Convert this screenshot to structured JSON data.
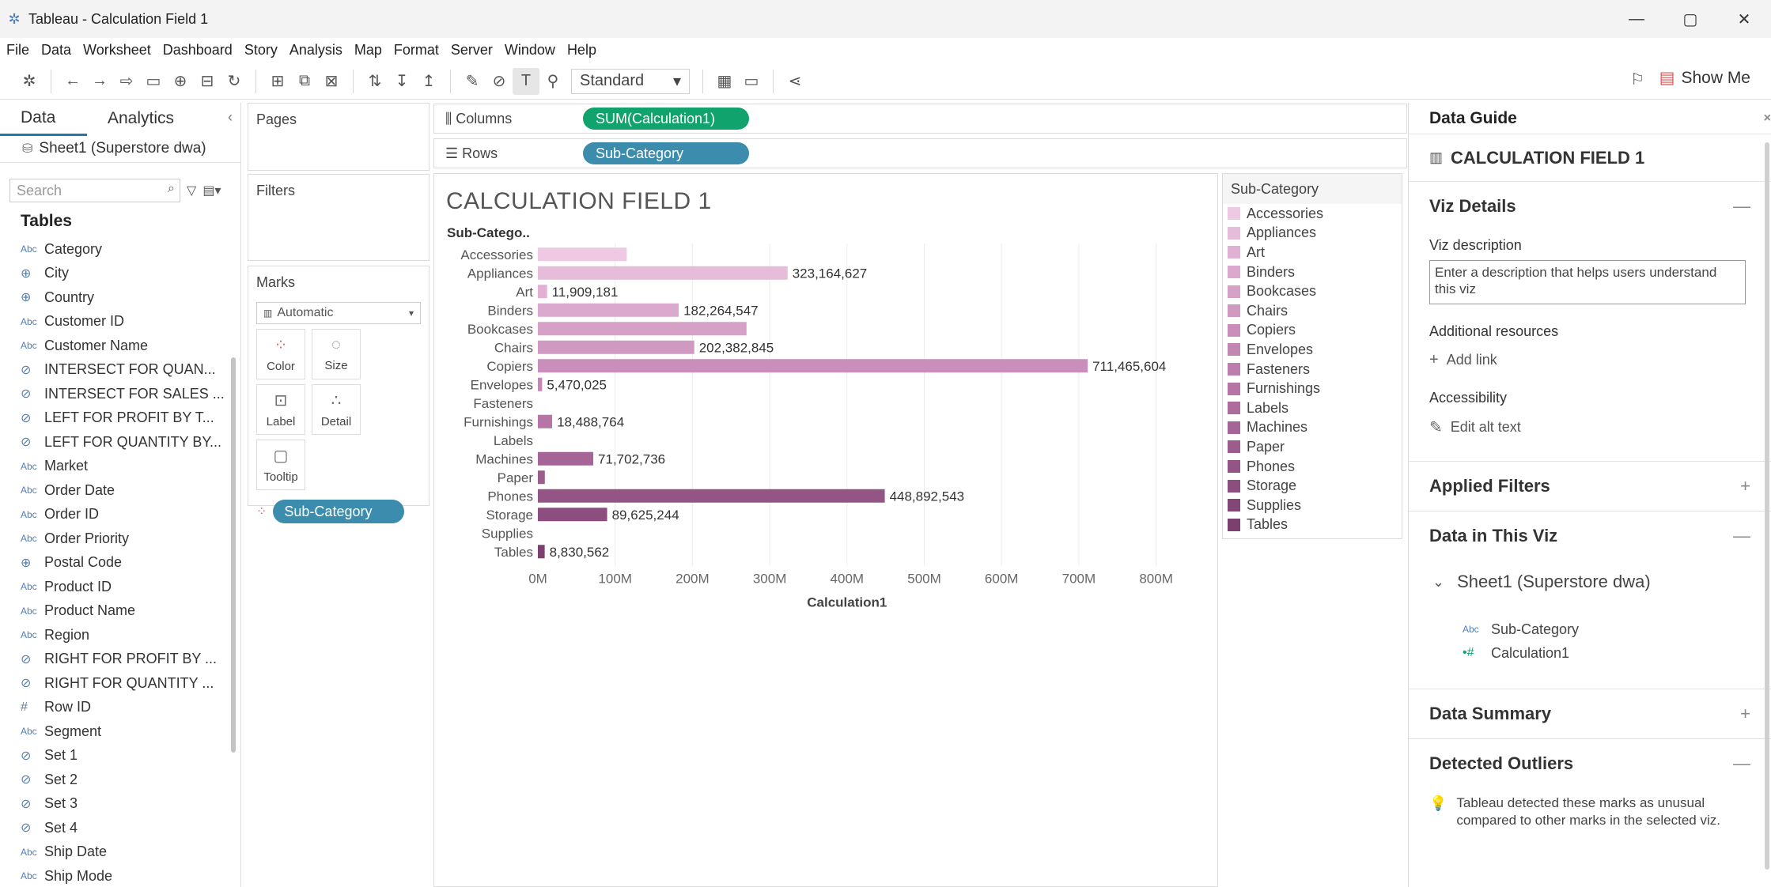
{
  "window": {
    "title": "Tableau - Calculation Field 1",
    "controls": [
      "—",
      "▢",
      "✕"
    ]
  },
  "menu": [
    "File",
    "Data",
    "Worksheet",
    "Dashboard",
    "Story",
    "Analysis",
    "Map",
    "Format",
    "Server",
    "Window",
    "Help"
  ],
  "toolbar": {
    "fit_select": "Standard",
    "show_me": "Show Me"
  },
  "left_panel": {
    "tab_data": "Data",
    "tab_analytics": "Analytics",
    "datasource": "Sheet1 (Superstore dwa)",
    "search_placeholder": "Search",
    "tables_heading": "Tables",
    "fields": [
      {
        "type": "Abc",
        "name": "Category"
      },
      {
        "type": "globe",
        "name": "City"
      },
      {
        "type": "globe",
        "name": "Country"
      },
      {
        "type": "Abc",
        "name": "Customer ID"
      },
      {
        "type": "Abc",
        "name": "Customer Name"
      },
      {
        "type": "set",
        "name": "INTERSECT FOR QUAN..."
      },
      {
        "type": "set",
        "name": "INTERSECT FOR SALES ..."
      },
      {
        "type": "set",
        "name": "LEFT FOR PROFIT BY T..."
      },
      {
        "type": "set",
        "name": "LEFT FOR QUANTITY BY..."
      },
      {
        "type": "Abc",
        "name": "Market"
      },
      {
        "type": "Abc",
        "name": "Order Date"
      },
      {
        "type": "Abc",
        "name": "Order ID"
      },
      {
        "type": "Abc",
        "name": "Order Priority"
      },
      {
        "type": "globe",
        "name": "Postal Code"
      },
      {
        "type": "Abc",
        "name": "Product ID"
      },
      {
        "type": "Abc",
        "name": "Product Name"
      },
      {
        "type": "Abc",
        "name": "Region"
      },
      {
        "type": "set",
        "name": "RIGHT FOR PROFIT BY ..."
      },
      {
        "type": "set",
        "name": "RIGHT FOR QUANTITY ..."
      },
      {
        "type": "num",
        "name": "Row ID"
      },
      {
        "type": "Abc",
        "name": "Segment"
      },
      {
        "type": "set",
        "name": "Set 1"
      },
      {
        "type": "set",
        "name": "Set 2"
      },
      {
        "type": "set",
        "name": "Set 3"
      },
      {
        "type": "set",
        "name": "Set 4"
      },
      {
        "type": "Abc",
        "name": "Ship Date"
      },
      {
        "type": "Abc",
        "name": "Ship Mode"
      }
    ]
  },
  "cards": {
    "pages": "Pages",
    "filters": "Filters",
    "marks": "Marks",
    "mark_type": "Automatic",
    "mark_buttons": [
      "Color",
      "Size",
      "Label",
      "Detail",
      "Tooltip"
    ],
    "marks_pill": "Sub-Category"
  },
  "shelves": {
    "columns_label": "Columns",
    "columns_pill": "SUM(Calculation1)",
    "rows_label": "Rows",
    "rows_pill": "Sub-Category"
  },
  "viz": {
    "title": "CALCULATION FIELD 1"
  },
  "legend": {
    "title": "Sub-Category"
  },
  "chart_data": {
    "type": "bar",
    "orientation": "horizontal",
    "row_header": "Sub-Catego..",
    "xlabel": "Calculation1",
    "xlim": [
      0,
      850000000
    ],
    "x_ticks": [
      {
        "value": 0,
        "label": "0M"
      },
      {
        "value": 100000000,
        "label": "100M"
      },
      {
        "value": 200000000,
        "label": "200M"
      },
      {
        "value": 300000000,
        "label": "300M"
      },
      {
        "value": 400000000,
        "label": "400M"
      },
      {
        "value": 500000000,
        "label": "500M"
      },
      {
        "value": 600000000,
        "label": "600M"
      },
      {
        "value": 700000000,
        "label": "700M"
      },
      {
        "value": 800000000,
        "label": "800M"
      }
    ],
    "categories": [
      "Accessories",
      "Appliances",
      "Art",
      "Binders",
      "Bookcases",
      "Chairs",
      "Copiers",
      "Envelopes",
      "Fasteners",
      "Furnishings",
      "Labels",
      "Machines",
      "Paper",
      "Phones",
      "Storage",
      "Supplies",
      "Tables"
    ],
    "values": [
      115000000,
      323164627,
      11909181,
      182264547,
      270000000,
      202382845,
      711465604,
      5470025,
      0,
      18488764,
      0,
      71702736,
      9000000,
      448892543,
      89625244,
      0,
      8830562
    ],
    "data_labels": [
      "",
      "323,164,627",
      "11,909,181",
      "182,264,547",
      "",
      "202,382,845",
      "711,465,604",
      "5,470,025",
      "",
      "18,488,764",
      "",
      "71,702,736",
      "",
      "448,892,543",
      "89,625,244",
      "",
      "8,830,562"
    ],
    "colors": [
      "#efc9e3",
      "#e6bcdb",
      "#e0b1d3",
      "#dba9cd",
      "#d6a1c7",
      "#d099c1",
      "#c98fba",
      "#c387b3",
      "#bc7eac",
      "#b675a5",
      "#ad6c9c",
      "#a56596",
      "#9c5c8e",
      "#935586",
      "#8b4e7f",
      "#834777",
      "#7b4070"
    ],
    "grid": true,
    "legend": "right"
  },
  "guide": {
    "header": "Data Guide",
    "viz_name": "CALCULATION FIELD 1",
    "viz_details": "Viz Details",
    "viz_description_label": "Viz description",
    "viz_description_placeholder": "Enter a description that helps users understand this viz",
    "additional_resources": "Additional resources",
    "add_link": "Add link",
    "accessibility": "Accessibility",
    "edit_alt_text": "Edit alt text",
    "applied_filters": "Applied Filters",
    "data_in_viz": "Data in This Viz",
    "ds_name": "Sheet1 (Superstore dwa)",
    "fields": [
      {
        "icon": "Abc",
        "name": "Sub-Category"
      },
      {
        "icon": "•#",
        "name": "Calculation1"
      }
    ],
    "data_summary": "Data Summary",
    "detected_outliers": "Detected Outliers",
    "outlier_note": "Tableau detected these marks as unusual compared to other marks in the selected viz."
  }
}
